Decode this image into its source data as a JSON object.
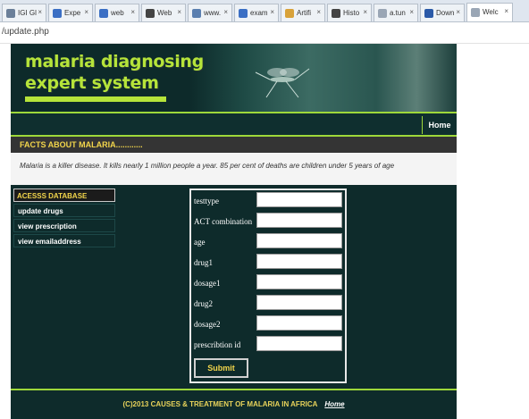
{
  "browser": {
    "tabs": [
      {
        "label": "IGI Gl",
        "color": "#6b7f99"
      },
      {
        "label": "Expe",
        "color": "#3b6fc4"
      },
      {
        "label": "web",
        "color": "#3b6fc4"
      },
      {
        "label": "Web",
        "color": "#444444"
      },
      {
        "label": "www.",
        "color": "#5a7fb0"
      },
      {
        "label": "exam",
        "color": "#3b6fc4"
      },
      {
        "label": "Artifi",
        "color": "#d8a23a"
      },
      {
        "label": "Histo",
        "color": "#444444"
      },
      {
        "label": "a.tun",
        "color": "#9aa6b5"
      },
      {
        "label": "Down",
        "color": "#2b5aa8"
      },
      {
        "label": "Welc",
        "color": "#9aa6b5"
      }
    ],
    "close_glyph": "×",
    "url": "/update.php"
  },
  "site": {
    "logo_line1": "malaria diagnosing",
    "logo_line2": "expert system",
    "nav_home": "Home",
    "facts_heading": "FACTS ABOUT MALARIA............",
    "facts_text": "Malaria is a killer disease. It kills nearly 1 million people a year. 85 per cent of deaths are children under 5 years of age",
    "sidebar": {
      "heading": "ACESSS DATABASE",
      "items": [
        "update drugs",
        "view prescription",
        "view emailaddress"
      ]
    },
    "form": {
      "fields": [
        {
          "label": "testtype",
          "value": ""
        },
        {
          "label": "ACT combination",
          "value": ""
        },
        {
          "label": "age",
          "value": ""
        },
        {
          "label": "drug1",
          "value": ""
        },
        {
          "label": "dosage1",
          "value": ""
        },
        {
          "label": "drug2",
          "value": ""
        },
        {
          "label": "dosage2",
          "value": ""
        },
        {
          "label": "prescribtion id",
          "value": ""
        }
      ],
      "submit_label": "Submit"
    },
    "footer_text": "(C)2013 CAUSES & TREATMENT OF MALARIA IN AFRICA",
    "footer_home": "Home"
  },
  "colors": {
    "accent_green": "#9ed83a",
    "dark_teal": "#0e2b2b",
    "gold": "#f2d54b"
  }
}
